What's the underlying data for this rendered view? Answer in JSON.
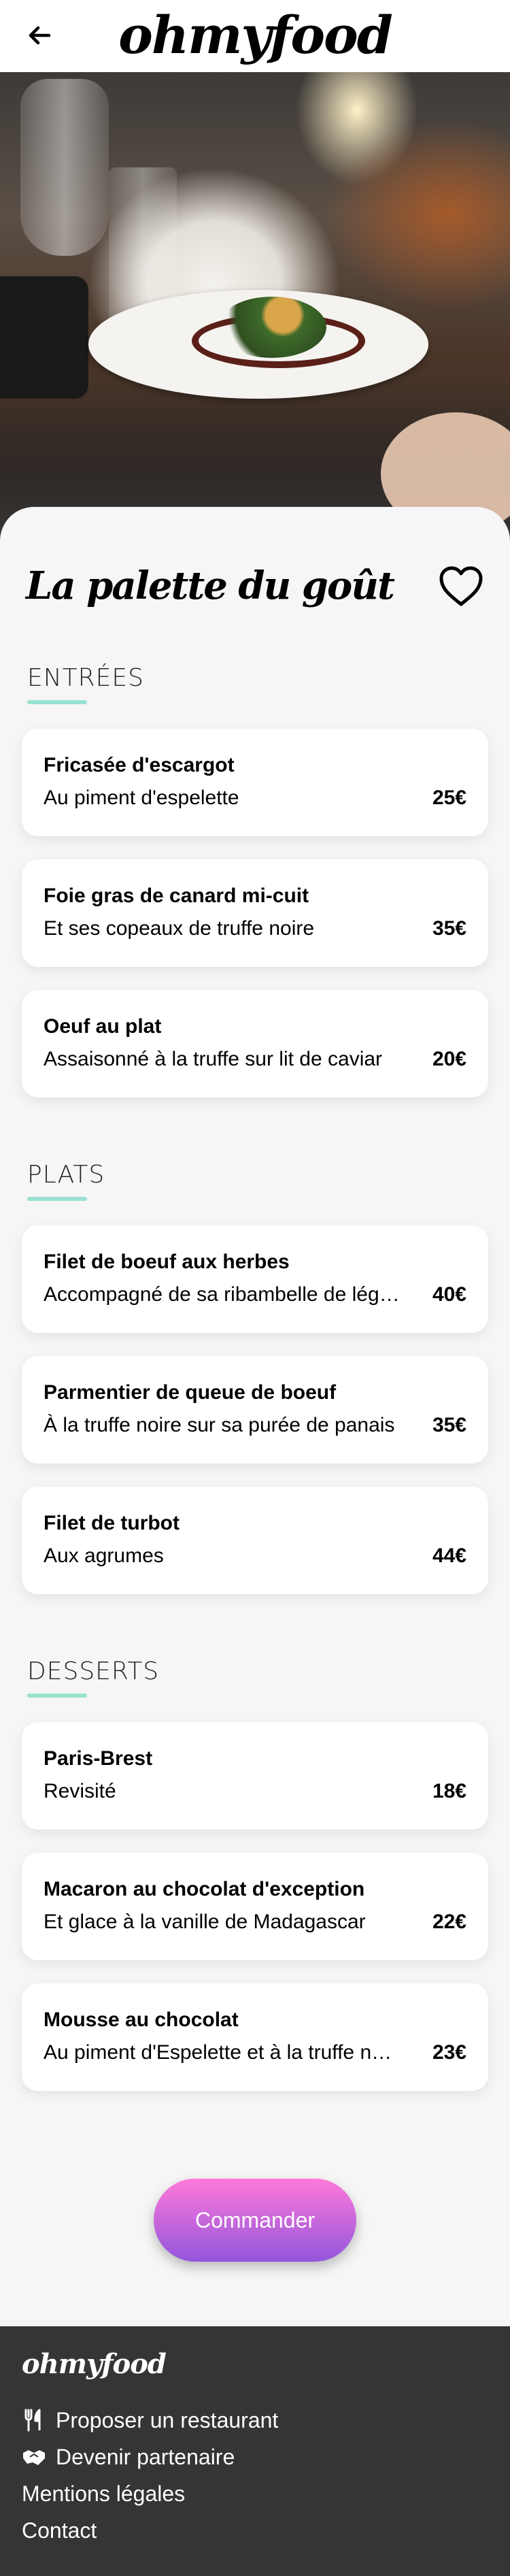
{
  "header": {
    "logo": "ohmyfood",
    "back_icon": "arrow-left-icon"
  },
  "restaurant": {
    "name": "La palette du goût",
    "favorite_icon": "heart-outline-icon"
  },
  "sections": [
    {
      "title": "ENTRÉES",
      "dishes": [
        {
          "name": "Fricasée d'escargot",
          "description": "Au piment d'espelette",
          "price": "25€"
        },
        {
          "name": "Foie gras de canard mi-cuit",
          "description": "Et ses copeaux de truffe noire",
          "price": "35€"
        },
        {
          "name": "Oeuf au plat",
          "description": "Assaisonné à la truffe sur lit de caviar",
          "price": "20€"
        }
      ]
    },
    {
      "title": "PLATS",
      "dishes": [
        {
          "name": "Filet de boeuf aux herbes",
          "description": "Accompagné de sa ribambelle de lég…",
          "price": "40€"
        },
        {
          "name": "Parmentier de queue de boeuf",
          "description": "À la truffe noire sur sa purée de panais",
          "price": "35€"
        },
        {
          "name": "Filet de turbot",
          "description": "Aux agrumes",
          "price": "44€"
        }
      ]
    },
    {
      "title": "DESSERTS",
      "dishes": [
        {
          "name": "Paris-Brest",
          "description": "Revisité",
          "price": "18€"
        },
        {
          "name": "Macaron au chocolat d'exception",
          "description": "Et glace à la vanille de Madagascar",
          "price": "22€"
        },
        {
          "name": "Mousse au chocolat",
          "description": "Au piment d'Espelette et à la truffe n…",
          "price": "23€"
        }
      ]
    }
  ],
  "order_button": "Commander",
  "footer": {
    "logo": "ohmyfood",
    "links": [
      {
        "label": "Proposer un restaurant",
        "icon": "utensils-icon"
      },
      {
        "label": "Devenir partenaire",
        "icon": "handshake-icon"
      },
      {
        "label": "Mentions légales",
        "icon": ""
      },
      {
        "label": "Contact",
        "icon": ""
      }
    ]
  },
  "colors": {
    "accent_underline": "#99e2d0",
    "button_gradient_start": "#ff79da",
    "button_gradient_end": "#9356dc",
    "footer_bg": "#353535",
    "page_bg": "#f6f6f6"
  }
}
